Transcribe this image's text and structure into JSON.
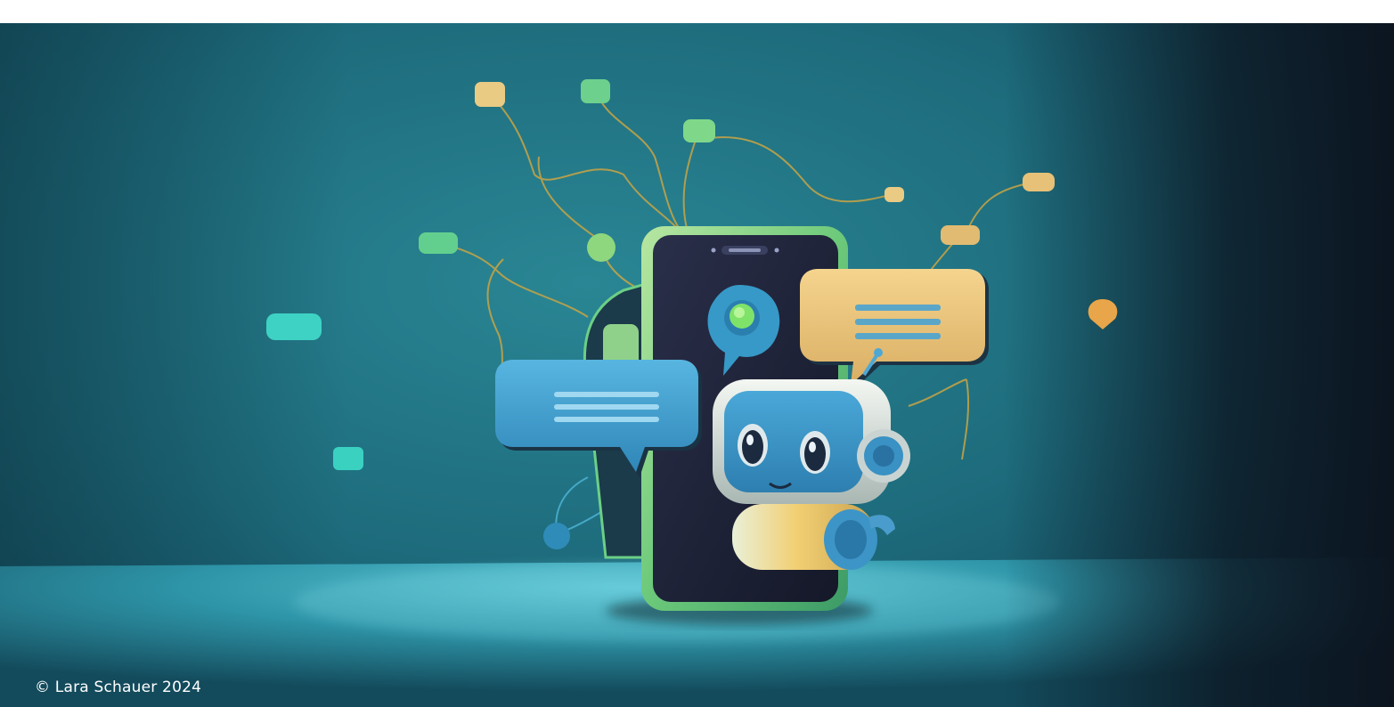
{
  "image": {
    "credit": "© Lara Schauer 2024",
    "scene": [
      "smartphone",
      "chat-robot",
      "speech-bubbles",
      "network-nodes"
    ],
    "colors": {
      "background_teal": "#1f6f7e",
      "background_dark": "#0d1520",
      "floor_light": "#4fb6c8",
      "bubble_blue": "#3b9fd0",
      "bubble_yellow": "#e7c178",
      "phone_frame": "#7fd27a",
      "phone_screen": "#1a1f33",
      "node_green": "#6ed08d",
      "node_yellow": "#e9cb84",
      "node_cyan": "#3ed2c4",
      "wire_gold": "#c9a544"
    }
  }
}
